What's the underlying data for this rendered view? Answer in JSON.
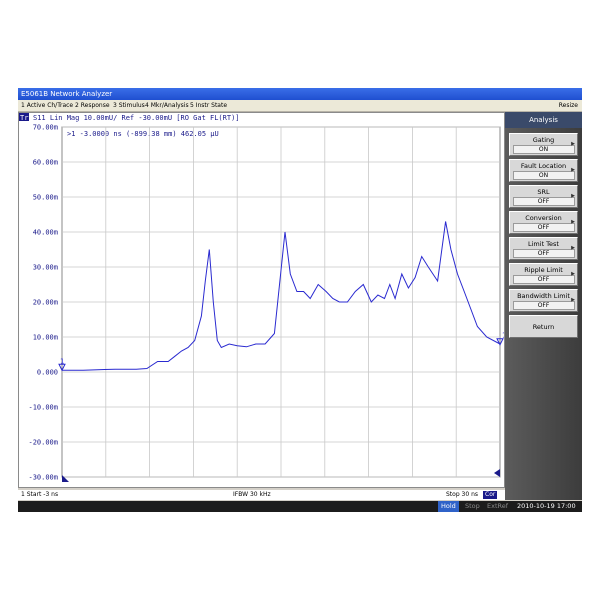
{
  "app": {
    "title": "E5061B Network Analyzer"
  },
  "menu": {
    "items": [
      "1 Active Ch/Trace",
      "2 Response",
      "3 Stimulus",
      "4 Mkr/Analysis",
      "5 Instr State"
    ],
    "resize": "Resize"
  },
  "trace_header": {
    "label": "Tr1",
    "text": "S11 Lin Mag 10.00mU/ Ref -30.00mU [RO Gat FL(RT)]"
  },
  "marker_readout": ">1 -3.0000 ns (-899.38 mm)  462.05 µU",
  "softkeys": {
    "title": "Analysis",
    "buttons": [
      {
        "label": "Gating",
        "value": "ON"
      },
      {
        "label": "Fault Location",
        "value": "ON"
      },
      {
        "label": "SRL",
        "value": "OFF"
      },
      {
        "label": "Conversion",
        "value": "OFF"
      },
      {
        "label": "Limit Test",
        "value": "OFF"
      },
      {
        "label": "Ripple Limit",
        "value": "OFF"
      },
      {
        "label": "Bandwidth Limit",
        "value": "OFF"
      },
      {
        "label": "Return",
        "value": ""
      }
    ]
  },
  "status": {
    "start": "1  Start -3 ns",
    "ifbw": "IFBW 30 kHz",
    "stop": "Stop 30 ns",
    "cor": "Cor"
  },
  "bottom": {
    "hold": "Hold",
    "stop": "Stop",
    "extref": "ExtRef",
    "datetime": "2010-10-19 17:00"
  },
  "colors": {
    "trace": "#2a2ad0",
    "grid": "#c8c8c8",
    "hold": "#2f62c8"
  },
  "chart_data": {
    "type": "line",
    "xlabel": "",
    "ylabel": "",
    "xlim": [
      -3,
      30
    ],
    "ylim": [
      -0.03,
      0.07
    ],
    "yticks": [
      "70.00m",
      "60.00m",
      "50.00m",
      "40.00m",
      "30.00m",
      "20.00m",
      "10.00m",
      "0.000",
      "-10.00m",
      "-20.00m",
      "-30.00m"
    ],
    "series": [
      {
        "x": [
          -3,
          -2.2,
          -1.4,
          -0.6,
          0.2,
          1,
          1.8,
          2.6,
          3.4,
          4.2,
          5,
          5.5,
          6,
          6.5,
          7,
          7.5,
          7.8,
          8.1,
          8.4,
          8.7,
          9,
          9.6,
          10.2,
          10.9,
          11.6,
          12.3,
          13,
          13.8,
          14.2,
          14.7,
          15.2,
          15.7,
          16.3,
          16.9,
          17.4,
          17.9,
          18.5,
          19.1,
          19.7,
          20.3,
          20.8,
          21.3,
          21.7,
          22.1,
          22.6,
          23.1,
          23.6,
          24.1,
          24.6,
          25.3,
          25.9,
          26.3,
          26.8,
          27.3,
          27.8,
          28.3,
          29,
          30
        ],
        "y": [
          0.0005,
          0.0005,
          0.0005,
          0.0006,
          0.0007,
          0.0008,
          0.0008,
          0.0008,
          0.001,
          0.003,
          0.003,
          0.0045,
          0.006,
          0.007,
          0.009,
          0.016,
          0.026,
          0.035,
          0.02,
          0.009,
          0.007,
          0.008,
          0.0075,
          0.0072,
          0.008,
          0.008,
          0.011,
          0.04,
          0.028,
          0.023,
          0.023,
          0.021,
          0.025,
          0.023,
          0.021,
          0.02,
          0.02,
          0.023,
          0.025,
          0.02,
          0.022,
          0.021,
          0.025,
          0.021,
          0.028,
          0.024,
          0.027,
          0.033,
          0.03,
          0.026,
          0.043,
          0.035,
          0.028,
          0.023,
          0.018,
          0.013,
          0.01,
          0.008
        ]
      }
    ],
    "markers": [
      {
        "label": "1",
        "x": -3,
        "y": 0.0005
      },
      {
        "label": "1",
        "x": 30,
        "y": 0.0078
      }
    ],
    "grid": true
  }
}
